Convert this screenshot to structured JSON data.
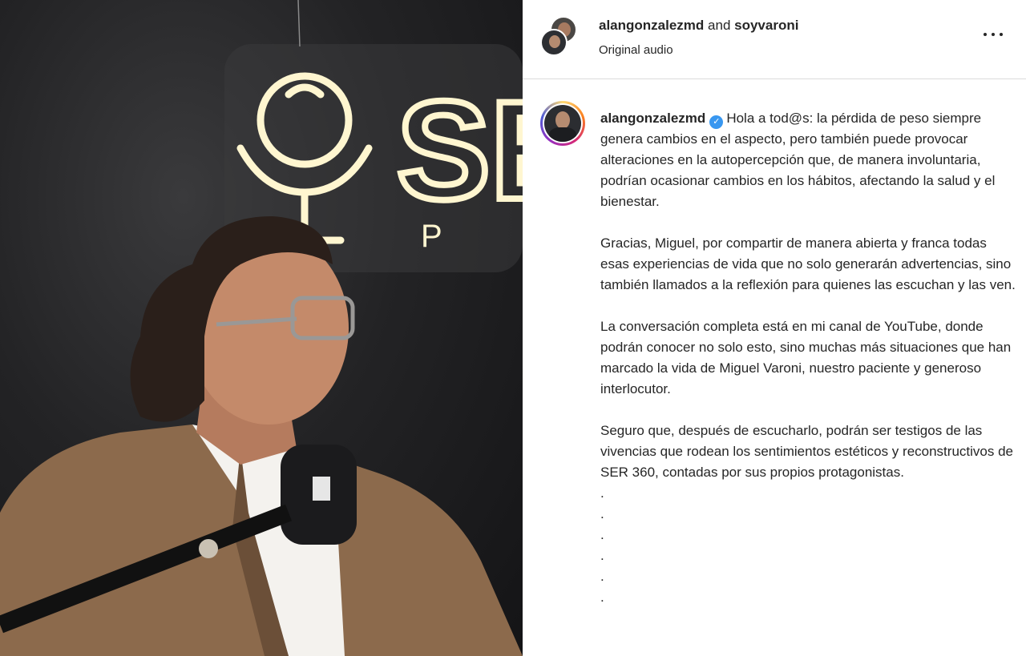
{
  "post": {
    "header": {
      "author_one": "alangonzalezmd",
      "joiner": " and ",
      "author_two": "soyvaroni",
      "audio_label": "Original audio",
      "more_icon": "more-horizontal-icon"
    },
    "caption": {
      "username": "alangonzalezmd",
      "verified_icon": "verified-badge-icon",
      "first_paragraph_text": "Hola a tod@s: la pérdida de peso siempre genera cambios en el aspecto, pero también puede provocar alteraciones en la autopercepción que, de manera involuntaria, podrían ocasionar cambios en los hábitos, afectando la salud y el bienestar.",
      "paragraphs": [
        "Gracias, Miguel, por compartir de manera abierta y franca todas esas experiencias de vida que no solo generarán advertencias, sino también llamados a la reflexión para quienes las escuchan y las ven.",
        "La conversación completa está en mi canal de YouTube, donde podrán conocer no solo esto, sino muchas más situaciones que han marcado la vida de Miguel Varoni, nuestro paciente y generoso interlocutor.",
        "Seguro que, después de escucharlo, podrán ser testigos de las vivencias que rodean los sentimientos estéticos y reconstructivos de SER 360, contadas por sus propios protagonistas."
      ],
      "dot_lines": [
        ".",
        ".",
        ".",
        ".",
        ".",
        "."
      ]
    }
  },
  "media": {
    "neon_sign_letters": "SE",
    "neon_sign_sub": "P O",
    "neon_color": "#fff3c4"
  },
  "colors": {
    "text": "#262626",
    "divider": "#dbdbdb",
    "verified": "#3897f0"
  }
}
